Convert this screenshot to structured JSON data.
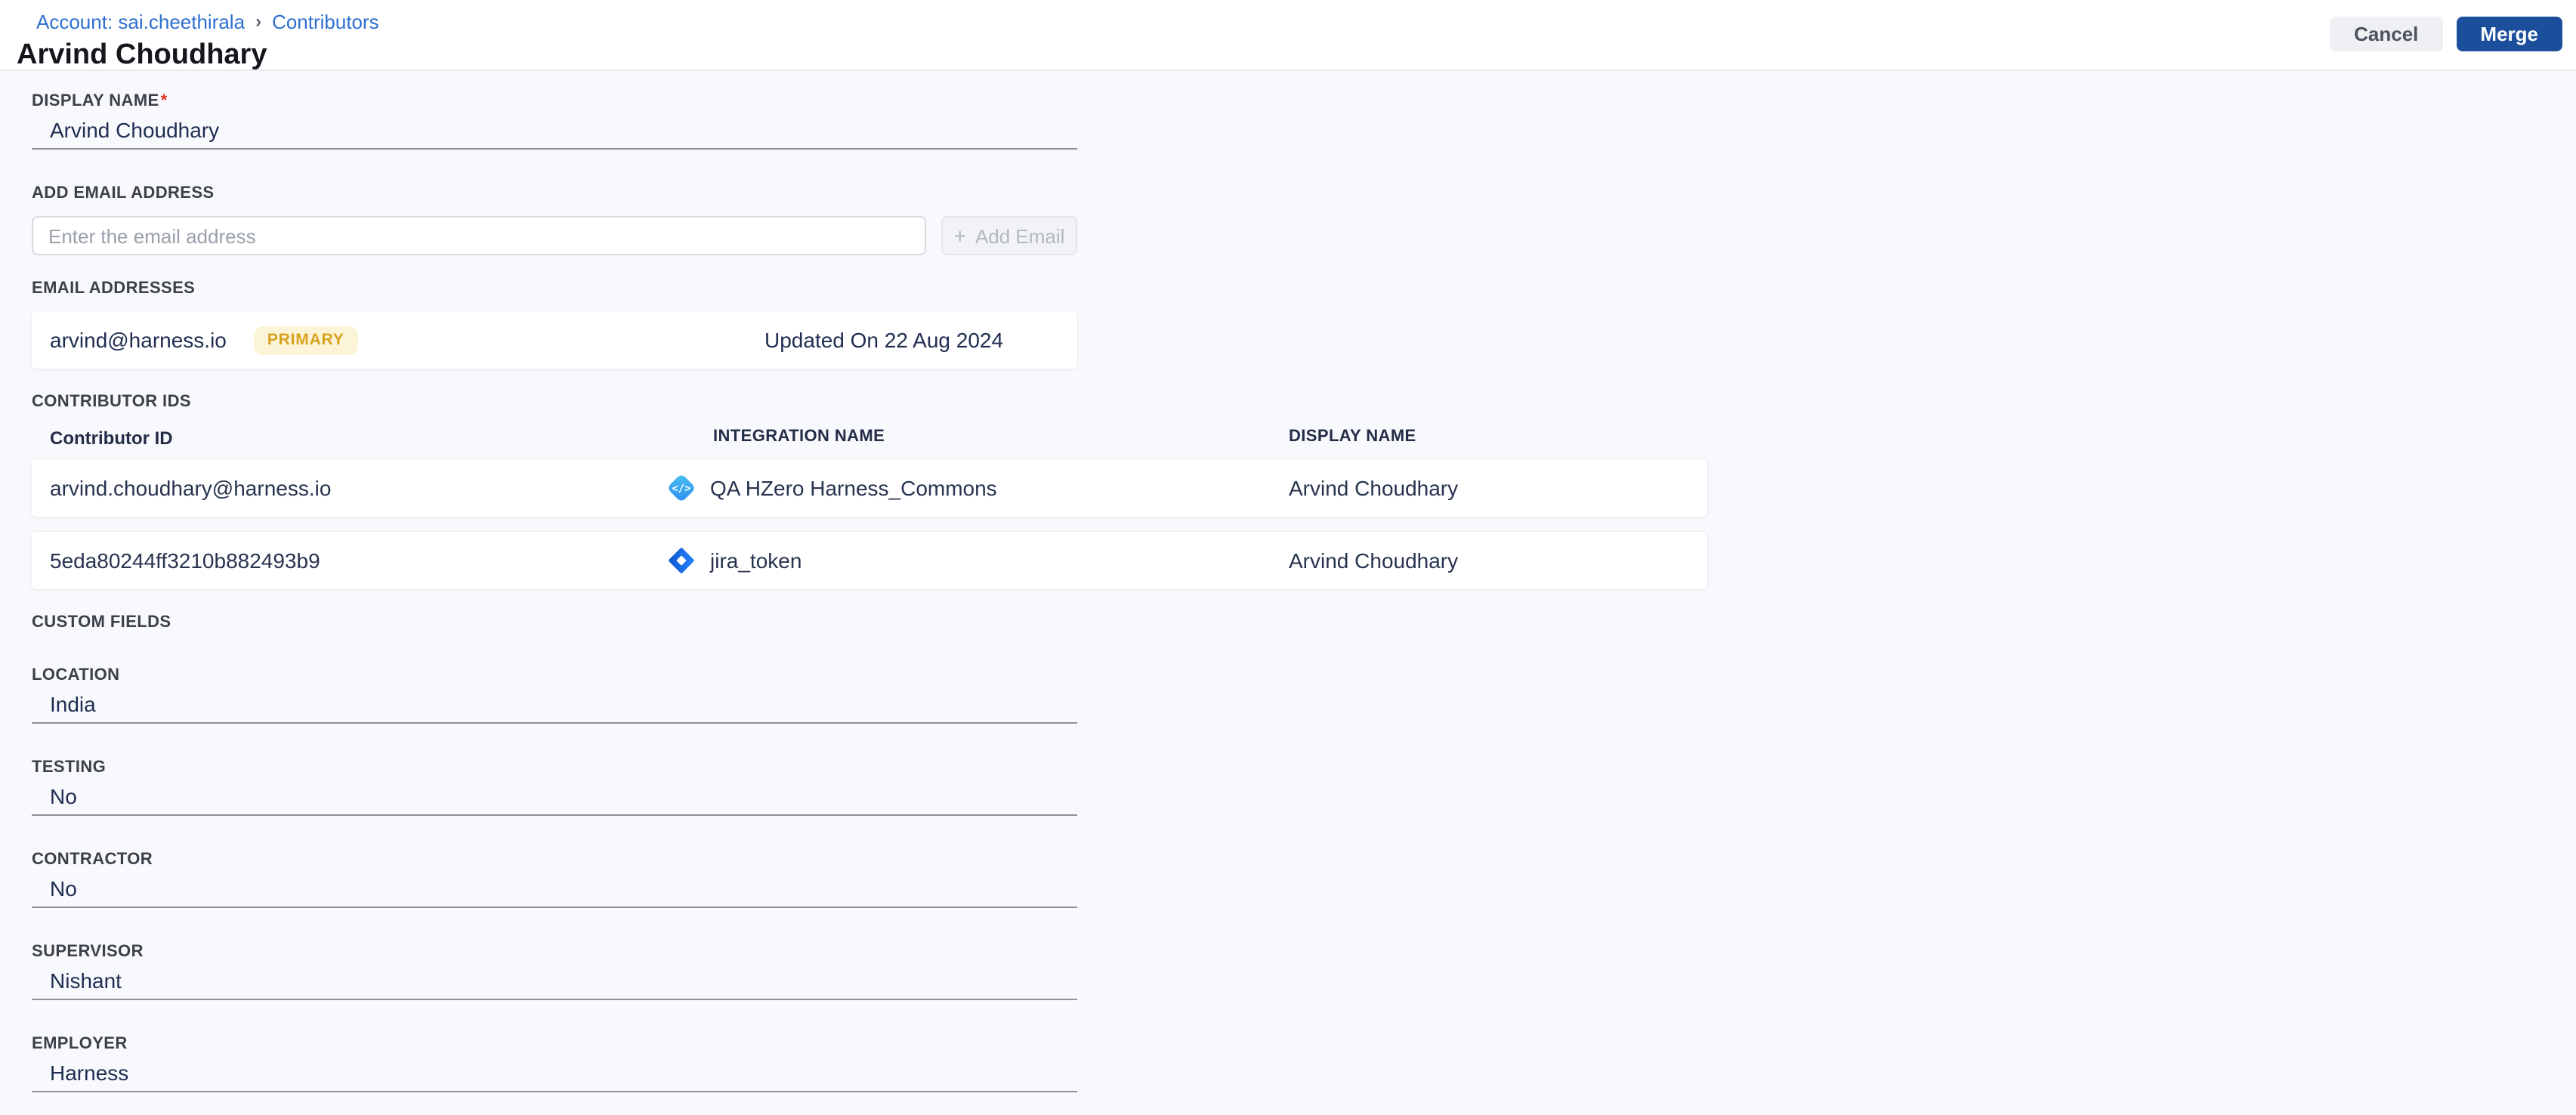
{
  "breadcrumb": {
    "account_label": "Account: sai.cheethirala",
    "separator": "›",
    "contributors_label": "Contributors"
  },
  "header": {
    "title": "Arvind Choudhary",
    "cancel_label": "Cancel",
    "merge_label": "Merge"
  },
  "display_name": {
    "label": "DISPLAY NAME",
    "required_marker": "*",
    "value": "Arvind Choudhary"
  },
  "add_email": {
    "label": "ADD EMAIL ADDRESS",
    "placeholder": "Enter the email address",
    "plus_icon": "+",
    "button_label": "Add Email"
  },
  "email_addresses": {
    "label": "EMAIL ADDRESSES",
    "rows": [
      {
        "email": "arvind@harness.io",
        "badge": "PRIMARY",
        "updated": "Updated On 22 Aug 2024"
      }
    ]
  },
  "contributor_ids": {
    "label": "CONTRIBUTOR IDS",
    "columns": {
      "id": "Contributor ID",
      "integration": "INTEGRATION NAME",
      "display_name": "DISPLAY NAME"
    },
    "rows": [
      {
        "id": "arvind.choudhary@harness.io",
        "icon": "code-integration-icon",
        "integration": "QA HZero Harness_Commons",
        "display_name": "Arvind Choudhary"
      },
      {
        "id": "5eda80244ff3210b882493b9",
        "icon": "jira-icon",
        "integration": "jira_token",
        "display_name": "Arvind Choudhary"
      }
    ]
  },
  "custom_fields": {
    "label": "CUSTOM FIELDS",
    "fields": [
      {
        "label": "LOCATION",
        "value": "India"
      },
      {
        "label": "TESTING",
        "value": "No"
      },
      {
        "label": "CONTRACTOR",
        "value": "No"
      },
      {
        "label": "SUPERVISOR",
        "value": "Nishant"
      },
      {
        "label": "EMPLOYER",
        "value": "Harness"
      }
    ]
  },
  "colors": {
    "breadcrumb_blue": "#2e6fd0",
    "merge_button_bg": "#1b4f9c",
    "cancel_button_bg": "#eef0f4",
    "primary_badge_bg": "#fcf4d7",
    "primary_badge_text": "#d7a21c",
    "value_text": "#1f2d52",
    "page_bg": "#f8f9fd",
    "underline_gray": "#8f9197",
    "required_red": "#e43326"
  }
}
